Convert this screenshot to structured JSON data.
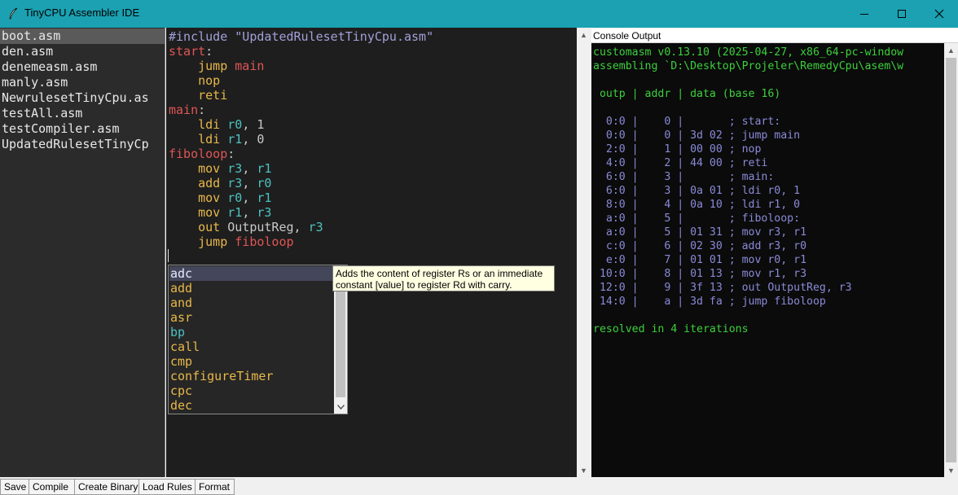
{
  "window": {
    "title": "TinyCPU Assembler IDE",
    "minimize_icon": "minimize-icon",
    "maximize_icon": "maximize-icon",
    "close_icon": "close-icon",
    "titlebar_color": "#1ba1b2"
  },
  "files": [
    {
      "name": "boot.asm",
      "selected": true
    },
    {
      "name": "den.asm",
      "selected": false
    },
    {
      "name": "denemeasm.asm",
      "selected": false
    },
    {
      "name": "manly.asm",
      "selected": false
    },
    {
      "name": "NewrulesetTinyCpu.as",
      "selected": false
    },
    {
      "name": "testAll.asm",
      "selected": false
    },
    {
      "name": "testCompiler.asm",
      "selected": false
    },
    {
      "name": "UpdatedRulesetTinyCp",
      "selected": false
    }
  ],
  "editor": {
    "lines": [
      [
        [
          "dir",
          "#include "
        ],
        [
          "str",
          "\"UpdatedRulesetTinyCpu.asm\""
        ]
      ],
      [
        [
          "label",
          "start"
        ],
        [
          "txt",
          ":"
        ]
      ],
      [
        [
          "txt",
          "    "
        ],
        [
          "op",
          "jump "
        ],
        [
          "ref",
          "main"
        ]
      ],
      [
        [
          "txt",
          "    "
        ],
        [
          "op",
          "nop"
        ]
      ],
      [
        [
          "txt",
          "    "
        ],
        [
          "op",
          "reti"
        ]
      ],
      [
        [
          "label",
          "main"
        ],
        [
          "txt",
          ":"
        ]
      ],
      [
        [
          "txt",
          "    "
        ],
        [
          "op",
          "ldi "
        ],
        [
          "reg",
          "r0"
        ],
        [
          "txt",
          ", 1"
        ]
      ],
      [
        [
          "txt",
          "    "
        ],
        [
          "op",
          "ldi "
        ],
        [
          "reg",
          "r1"
        ],
        [
          "txt",
          ", 0"
        ]
      ],
      [
        [
          "label",
          "fiboloop"
        ],
        [
          "txt",
          ":"
        ]
      ],
      [
        [
          "txt",
          "    "
        ],
        [
          "op",
          "mov "
        ],
        [
          "reg",
          "r3"
        ],
        [
          "txt",
          ", "
        ],
        [
          "reg",
          "r1"
        ]
      ],
      [
        [
          "txt",
          "    "
        ],
        [
          "op",
          "add "
        ],
        [
          "reg",
          "r3"
        ],
        [
          "txt",
          ", "
        ],
        [
          "reg",
          "r0"
        ]
      ],
      [
        [
          "txt",
          "    "
        ],
        [
          "op",
          "mov "
        ],
        [
          "reg",
          "r0"
        ],
        [
          "txt",
          ", "
        ],
        [
          "reg",
          "r1"
        ]
      ],
      [
        [
          "txt",
          "    "
        ],
        [
          "op",
          "mov "
        ],
        [
          "reg",
          "r1"
        ],
        [
          "txt",
          ", "
        ],
        [
          "reg",
          "r3"
        ]
      ],
      [
        [
          "txt",
          "    "
        ],
        [
          "op",
          "out "
        ],
        [
          "txt",
          "OutputReg, "
        ],
        [
          "reg",
          "r3"
        ]
      ],
      [
        [
          "txt",
          "    "
        ],
        [
          "op",
          "jump "
        ],
        [
          "ref",
          "fiboloop"
        ]
      ]
    ]
  },
  "autocomplete": {
    "items": [
      {
        "label": "adc",
        "kind": "op",
        "selected": true
      },
      {
        "label": "add",
        "kind": "op",
        "selected": false
      },
      {
        "label": "and",
        "kind": "op",
        "selected": false
      },
      {
        "label": "asr",
        "kind": "op",
        "selected": false
      },
      {
        "label": "bp",
        "kind": "kw",
        "selected": false
      },
      {
        "label": "call",
        "kind": "op",
        "selected": false
      },
      {
        "label": "cmp",
        "kind": "op",
        "selected": false
      },
      {
        "label": "configureTimer",
        "kind": "op",
        "selected": false
      },
      {
        "label": "cpc",
        "kind": "op",
        "selected": false
      },
      {
        "label": "dec",
        "kind": "op",
        "selected": false
      }
    ],
    "tooltip_line1": "Adds the content of register Rs or an immediate",
    "tooltip_line2": "constant [value] to register Rd with carry.",
    "scroll_down_icon": "chevron-down-icon"
  },
  "console": {
    "title": "Console Output",
    "lines": [
      {
        "text": "customasm v0.13.10 (2025-04-27, x86_64-pc-window",
        "color": "green"
      },
      {
        "text": "assembling `D:\\Desktop\\Projeler\\RemedyCpu\\asem\\w",
        "color": "green"
      },
      {
        "text": "",
        "color": "green"
      },
      {
        "text": " outp | addr | data (base 16)",
        "color": "green"
      },
      {
        "text": "",
        "color": "green"
      },
      {
        "text": "  0:0 |    0 |       ; start:",
        "color": "purple"
      },
      {
        "text": "  0:0 |    0 | 3d 02 ; jump main",
        "color": "purple"
      },
      {
        "text": "  2:0 |    1 | 00 00 ; nop",
        "color": "purple"
      },
      {
        "text": "  4:0 |    2 | 44 00 ; reti",
        "color": "purple"
      },
      {
        "text": "  6:0 |    3 |       ; main:",
        "color": "purple"
      },
      {
        "text": "  6:0 |    3 | 0a 01 ; ldi r0, 1",
        "color": "purple"
      },
      {
        "text": "  8:0 |    4 | 0a 10 ; ldi r1, 0",
        "color": "purple"
      },
      {
        "text": "  a:0 |    5 |       ; fiboloop:",
        "color": "purple"
      },
      {
        "text": "  a:0 |    5 | 01 31 ; mov r3, r1",
        "color": "purple"
      },
      {
        "text": "  c:0 |    6 | 02 30 ; add r3, r0",
        "color": "purple"
      },
      {
        "text": "  e:0 |    7 | 01 01 ; mov r0, r1",
        "color": "purple"
      },
      {
        "text": " 10:0 |    8 | 01 13 ; mov r1, r3",
        "color": "purple"
      },
      {
        "text": " 12:0 |    9 | 3f 13 ; out OutputReg, r3",
        "color": "purple"
      },
      {
        "text": " 14:0 |    a | 3d fa ; jump fiboloop",
        "color": "purple"
      },
      {
        "text": "",
        "color": "green"
      },
      {
        "text": "resolved in 4 iterations",
        "color": "green"
      }
    ]
  },
  "toolbar": {
    "buttons": [
      "Save",
      "Compile",
      "Create Binary",
      "Load Rules",
      "Format"
    ]
  },
  "colors": {
    "editor_bg": "#1e1e1e",
    "opcode": "#e8b84a",
    "register": "#4cc2bf",
    "label": "#e05555",
    "console_green": "#3cd03c",
    "console_purple": "#8a8ad8"
  }
}
